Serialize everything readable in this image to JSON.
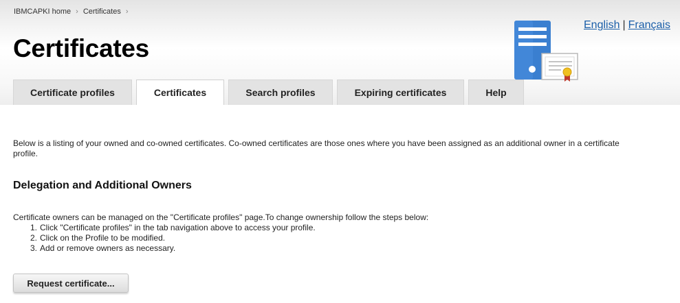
{
  "breadcrumb": {
    "items": [
      {
        "label": "IBMCAPKI home"
      },
      {
        "label": "Certificates"
      }
    ],
    "separator": "›"
  },
  "header": {
    "title": "Certificates",
    "languages": {
      "english": "English",
      "separator": "|",
      "french": "Français"
    },
    "icon": "server-certificate-icon"
  },
  "tabs": [
    {
      "label": "Certificate profiles",
      "active": false
    },
    {
      "label": "Certificates",
      "active": true
    },
    {
      "label": "Search profiles",
      "active": false
    },
    {
      "label": "Expiring certificates",
      "active": false
    },
    {
      "label": "Help",
      "active": false
    }
  ],
  "main": {
    "intro": "Below is a listing of your owned and co-owned certificates. Co-owned certificates are those ones where you have been assigned as an additional owner in a certificate profile.",
    "section_heading": "Delegation and Additional Owners",
    "owners_text": "Certificate owners can be managed on the \"Certificate profiles\" page.To change ownership follow the steps below:",
    "steps": [
      {
        "num": "1.",
        "text": "Click \"Certificate profiles\" in the tab navigation above to access your profile."
      },
      {
        "num": "2.",
        "text": "Click on the Profile to be modified."
      },
      {
        "num": "3.",
        "text": "Add or remove owners as necessary."
      }
    ],
    "request_button_label": "Request certificate..."
  },
  "colors": {
    "link": "#1a5ea8",
    "server_blue": "#3a7fd0",
    "ribbon_red": "#c0392b",
    "seal_gold": "#f0c020"
  }
}
